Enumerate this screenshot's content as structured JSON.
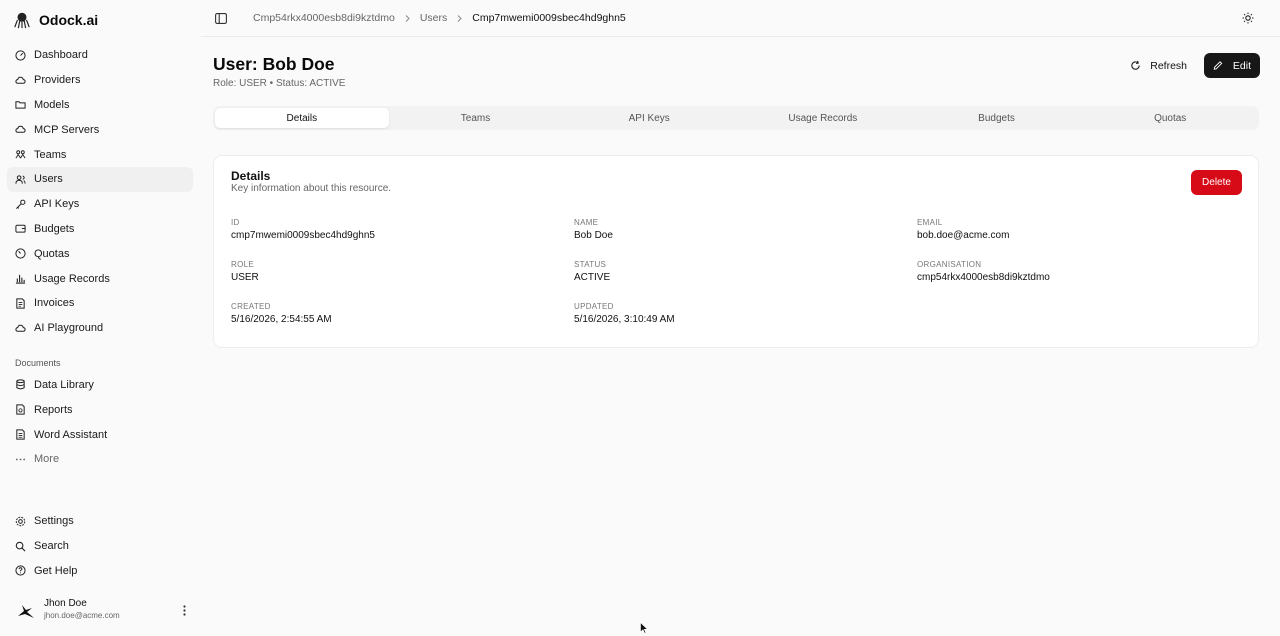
{
  "brand": {
    "name": "Odock.ai"
  },
  "sidebar": {
    "items": [
      {
        "label": "Dashboard",
        "icon": "dashboard-icon"
      },
      {
        "label": "Providers",
        "icon": "cloud-icon"
      },
      {
        "label": "Models",
        "icon": "folder-icon"
      },
      {
        "label": "MCP Servers",
        "icon": "server-icon"
      },
      {
        "label": "Teams",
        "icon": "teams-icon"
      },
      {
        "label": "Users",
        "icon": "users-icon",
        "active": true
      },
      {
        "label": "API Keys",
        "icon": "key-icon"
      },
      {
        "label": "Budgets",
        "icon": "wallet-icon"
      },
      {
        "label": "Quotas",
        "icon": "gauge-icon"
      },
      {
        "label": "Usage Records",
        "icon": "bar-chart-icon"
      },
      {
        "label": "Invoices",
        "icon": "invoice-icon"
      },
      {
        "label": "AI Playground",
        "icon": "playground-icon"
      }
    ],
    "documents_label": "Documents",
    "documents": [
      {
        "label": "Data Library",
        "icon": "database-icon"
      },
      {
        "label": "Reports",
        "icon": "report-icon"
      },
      {
        "label": "Word Assistant",
        "icon": "document-icon"
      },
      {
        "label": "More",
        "icon": "more-icon"
      }
    ],
    "bottom": [
      {
        "label": "Settings",
        "icon": "gear-icon"
      },
      {
        "label": "Search",
        "icon": "search-icon"
      },
      {
        "label": "Get Help",
        "icon": "help-icon"
      }
    ],
    "user": {
      "name": "Jhon Doe",
      "email": "jhon.doe@acme.com"
    }
  },
  "breadcrumb": {
    "org": "Cmp54rkx4000esb8di9kztdmo",
    "section": "Users",
    "current": "Cmp7mwemi0009sbec4hd9ghn5"
  },
  "header": {
    "title": "User: Bob Doe",
    "subtitle": "Role: USER • Status: ACTIVE",
    "refresh_label": "Refresh",
    "edit_label": "Edit"
  },
  "tabs": [
    "Details",
    "Teams",
    "API Keys",
    "Usage Records",
    "Budgets",
    "Quotas"
  ],
  "details": {
    "title": "Details",
    "description": "Key information about this resource.",
    "delete_label": "Delete",
    "fields": {
      "id": {
        "label": "ID",
        "value": "cmp7mwemi0009sbec4hd9ghn5"
      },
      "name": {
        "label": "NAME",
        "value": "Bob Doe"
      },
      "email": {
        "label": "EMAIL",
        "value": "bob.doe@acme.com"
      },
      "role": {
        "label": "ROLE",
        "value": "USER"
      },
      "status": {
        "label": "STATUS",
        "value": "ACTIVE"
      },
      "organisation": {
        "label": "ORGANISATION",
        "value": "cmp54rkx4000esb8di9kztdmo"
      },
      "created": {
        "label": "CREATED",
        "value": "5/16/2026, 2:54:55 AM"
      },
      "updated": {
        "label": "UPDATED",
        "value": "5/16/2026, 3:10:49 AM"
      }
    }
  },
  "colors": {
    "accent": "#171717",
    "danger": "#d70a17",
    "background": "#fafafa"
  }
}
